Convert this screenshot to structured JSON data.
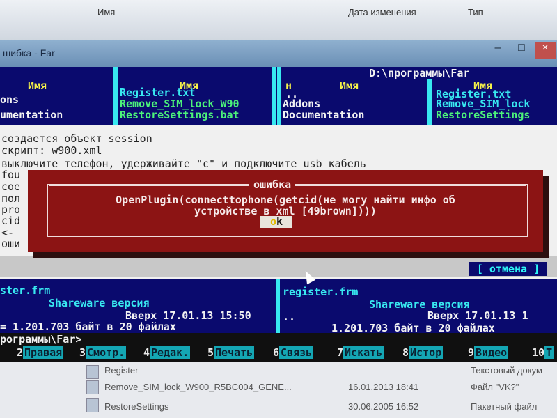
{
  "explorer": {
    "col_name": "Имя",
    "col_date": "Дата изменения",
    "col_type": "Тип",
    "files": [
      {
        "name": "Register",
        "date": "",
        "type": "Текстовый докум"
      },
      {
        "name": "Remove_SIM_lock_W900_R5BC004_GENE...",
        "date": "16.01.2013 18:41",
        "type": "Файл \"VK?\""
      },
      {
        "name": "RestoreSettings",
        "date": "30.06.2005 16:52",
        "type": "Пакетный файл"
      }
    ]
  },
  "window": {
    "title": "шибка - Far"
  },
  "far": {
    "path": "D:\\программы\\Far",
    "col_name": "Имя",
    "col_n": "н",
    "left": {
      "inner_items": [
        "ons",
        "umentation"
      ],
      "items": [
        "Register.txt",
        "Remove_SIM_lock_W90",
        "RestoreSettings.bat"
      ],
      "status_file": "ster.frm",
      "shareware": "Shareware версия",
      "up_info": "Вверх 17.01.13 15:50",
      "bytes": "= 1.201.703 байт в 20 файлах"
    },
    "right": {
      "items": [
        "..",
        "Addons",
        "Documentation"
      ],
      "items2": [
        "Register.txt",
        "Remove_SIM_lock",
        "RestoreSettings"
      ],
      "status_file": "register.frm",
      "dots": "..",
      "shareware": "Shareware версия",
      "up_info": "Вверх 17.01.13 1",
      "bytes": "1.201.703 байт в 20 файлах"
    },
    "prompt": "рограммы\\Far>"
  },
  "console": {
    "lines": [
      "создается объект session",
      "скрипт: w900.xml",
      "выключите телефон, удерживайте \"c\" и подключите usb кабель",
      "fou",
      "coe",
      "пол",
      "pro",
      "cid",
      "<-",
      "оши"
    ]
  },
  "dialog": {
    "title": "ошибка",
    "line1": "OpenPlugin(connecttophone(getcid(не могу найти инфо об",
    "line2": "устройстве в xml [49brown])))",
    "ok_hot": "o",
    "ok_rest": "k",
    "cancel_label": "[ отмена ]"
  },
  "keybar": [
    {
      "num": "",
      "label": "Правая"
    },
    {
      "num": "3",
      "label": "Смотр."
    },
    {
      "num": "4",
      "label": "Редак."
    },
    {
      "num": "5",
      "label": "Печать"
    },
    {
      "num": "6",
      "label": "Связь"
    },
    {
      "num": "7",
      "label": "Искать"
    },
    {
      "num": "8",
      "label": "Истор"
    },
    {
      "num": "9",
      "label": "Видео"
    },
    {
      "num": "10",
      "label": "Т"
    }
  ],
  "keybar_first_num": "2",
  "colors": {
    "panel_bg": "#0a0a6e",
    "panel_text": "#2ef6f6",
    "dialog_bg": "#8c1414",
    "keybar_label": "#14a6b4"
  }
}
